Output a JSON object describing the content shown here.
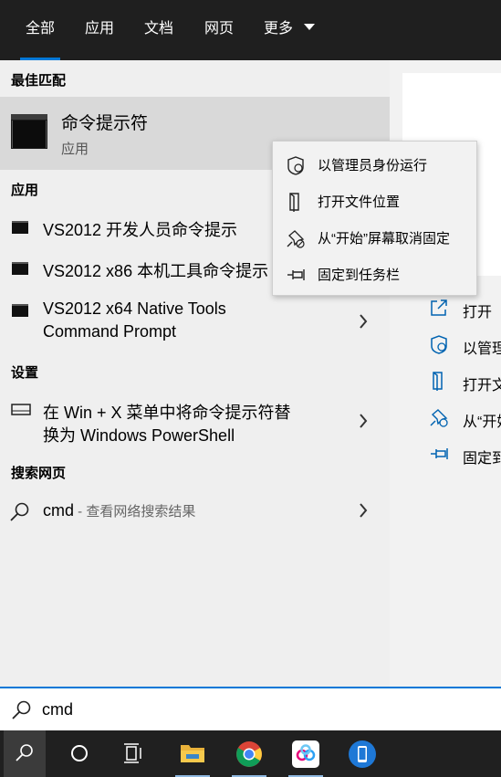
{
  "tabs": [
    {
      "label": "全部"
    },
    {
      "label": "应用"
    },
    {
      "label": "文档"
    },
    {
      "label": "网页"
    },
    {
      "label": "更多"
    }
  ],
  "best_match": {
    "header": "最佳匹配",
    "title": "命令提示符",
    "subtitle": "应用"
  },
  "apps": {
    "header": "应用",
    "items": [
      {
        "label": "VS2012 开发人员命令提示"
      },
      {
        "label": "VS2012 x86 本机工具命令提示"
      },
      {
        "line1": "VS2012 x64 Native Tools",
        "line2": "Command Prompt"
      }
    ]
  },
  "settings": {
    "header": "设置",
    "item": {
      "line1": "在 Win + X 菜单中将命令提示符替",
      "line2": "换为 Windows PowerShell"
    }
  },
  "web": {
    "header": "搜索网页",
    "query": "cmd",
    "suffix": " - 查看网络搜索结果"
  },
  "context_menu": [
    {
      "label": "以管理员身份运行",
      "icon": "shield-icon"
    },
    {
      "label": "打开文件位置",
      "icon": "file-location-icon"
    },
    {
      "label": "从“开始”屏幕取消固定",
      "icon": "unpin-icon"
    },
    {
      "label": "固定到任务栏",
      "icon": "pin-icon"
    }
  ],
  "preview_actions": [
    {
      "label": "打开",
      "icon": "open-icon"
    },
    {
      "label": "以管理",
      "icon": "shield-icon"
    },
    {
      "label": "打开文",
      "icon": "file-location-icon"
    },
    {
      "label": "从“开始",
      "icon": "unpin-icon"
    },
    {
      "label": "固定到",
      "icon": "pin-icon"
    }
  ],
  "search": {
    "value": "cmd"
  },
  "taskbar": [
    {
      "icon": "search-icon"
    },
    {
      "icon": "cortana-icon"
    },
    {
      "icon": "task-view-icon"
    },
    {
      "icon": "file-explorer-icon"
    },
    {
      "icon": "chrome-icon"
    },
    {
      "icon": "baidu-netdisk-icon"
    },
    {
      "icon": "phone-app-icon"
    }
  ],
  "colors": {
    "accent": "#0078d7",
    "tabbar_bg": "#1f1f1f",
    "results_bg": "#efefef",
    "selected_row": "#d9d9d9",
    "taskbar_bg": "#202020"
  }
}
